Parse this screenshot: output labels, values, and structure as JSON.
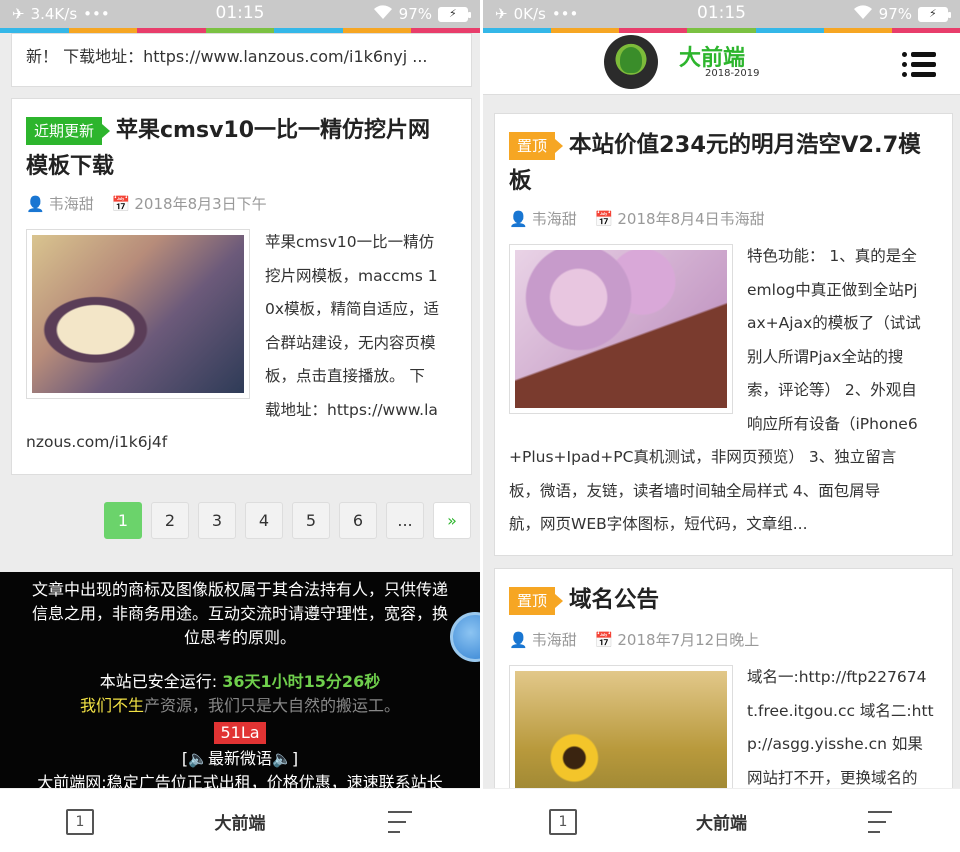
{
  "left": {
    "status": {
      "speed": "3.4K/s",
      "dots": "•••",
      "time": "01:15",
      "battery": "97%"
    },
    "prev_excerpt": "新！ 下载地址：https://www.lanzous.com/i1k6nyj ...",
    "post": {
      "tag": "近期更新",
      "title_line1": "苹果cmsv10一比一精仿挖片网",
      "title_line2": "模板下载",
      "author": "韦海甜",
      "date": "2018年8月3日下午",
      "excerpt_lines": [
        "苹果cmsv10一比一精仿",
        "挖片网模板，maccms 1",
        "0x模板，精简自适应，适",
        "合群站建设，无内容页模",
        "板，点击直接播放。 下",
        "载地址：https://www.la"
      ],
      "excerpt_tail": "nzous.com/i1k6j4f"
    },
    "pager": [
      "1",
      "2",
      "3",
      "4",
      "5",
      "6",
      "...",
      "»"
    ],
    "footer": {
      "line1": "文章中出现的商标及图像版权属于其合法持有人，只供传递",
      "line2": "信息之用，非商务用途。互动交流时请遵守理性，宽容，换",
      "line3": "位思考的原则。",
      "uptime_label": "本站已安全运行: ",
      "uptime_value": "36天1小时15分26秒",
      "slogan_yellow": "我们不生",
      "slogan_gray": "产资源，我们只是大自然的搬运工。",
      "badge": "51La",
      "weibo": "[🔈最新微语🔈]",
      "ad": "大前端网:稳定广告位正式出租，价格优惠，速速联系站长"
    },
    "nav": {
      "tabs": "1",
      "title": "大前端"
    }
  },
  "right": {
    "status": {
      "speed": "0K/s",
      "dots": "•••",
      "time": "01:15",
      "battery": "97%"
    },
    "logo": {
      "text": "大前端",
      "year": "2018-2019"
    },
    "post1": {
      "tag": "置顶",
      "title_line1": "本站价值234元的明月浩空V2.7模",
      "title_line2": "板",
      "author": "韦海甜",
      "date": "2018年8月4日韦海甜",
      "excerpt_lines": [
        "特色功能： 1、真的是全",
        "emlog中真正做到全站Pj",
        "ax+Ajax的模板了（试试",
        "别人所谓Pjax全站的搜",
        "索，评论等） 2、外观自",
        "响应所有设备（iPhone6"
      ],
      "excerpt_tail": [
        "+Plus+Ipad+PC真机测试，非网页预览） 3、独立留言",
        "板，微语，友链，读者墙时间轴全局样式 4、面包屑导",
        "航，网页WEB字体图标，短代码，文章组..."
      ]
    },
    "post2": {
      "tag": "置顶",
      "title": "域名公告",
      "author": "韦海甜",
      "date": "2018年7月12日晚上",
      "excerpt_lines": [
        "域名一:http://ftp227674",
        "t.free.itgou.cc 域名二:htt",
        "p://asgg.yisshe.cn 如果",
        "网站打不开，更换域名的"
      ]
    },
    "nav": {
      "tabs": "1",
      "title": "大前端"
    }
  },
  "colors": {
    "green": "#2db52d",
    "orange": "#f6a623",
    "stripe": [
      "#34b7e8",
      "#f6a623",
      "#e83d6b",
      "#7bc142",
      "#34b7e8",
      "#f6a623",
      "#e83d6b"
    ]
  }
}
